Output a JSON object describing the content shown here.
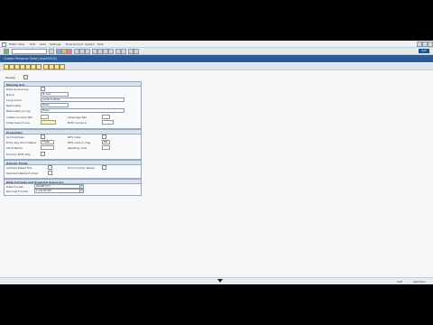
{
  "menu": {
    "items": [
      "Editor View",
      "Edit",
      "Goto",
      "Settings",
      "Environment",
      "System",
      "Help"
    ]
  },
  "appbar": {
    "display_label": "Display"
  },
  "page": {
    "title": "Create Personal Data (Inlo#0002)"
  },
  "groups": {
    "naming": {
      "title": "Naming Sch.",
      "fields": [
        {
          "label": "Data Source key",
          "value": ""
        },
        {
          "label": "Name",
          "value": "Mr Luis"
        },
        {
          "label": "Long name",
          "value": "Lucille D. Brown"
        },
        {
          "label": "Nationality",
          "value": "Brown"
        },
        {
          "label": "Nationality (Long)",
          "value": "Brown"
        },
        {
          "label": "Initials Country Ref",
          "value": ""
        },
        {
          "label": "Initial Search Lev.",
          "value": ""
        }
      ],
      "right_fields": [
        {
          "label": "Language Ref",
          "value": ""
        },
        {
          "label": "Birth Currency",
          "value": ""
        }
      ]
    },
    "properties": {
      "title": "Properties",
      "fields": [
        {
          "label": "Sel Dummies",
          "value": ""
        },
        {
          "label": "Entry Key Short Name",
          "value": "TYLER"
        },
        {
          "label": "Short Name",
          "value": ""
        },
        {
          "label": "Dummy Birth Day",
          "value": ""
        }
      ],
      "right_fields": [
        {
          "label": "DES code",
          "value": ""
        },
        {
          "label": "DES code in msg",
          "value": "BIS"
        },
        {
          "label": "Wedding code",
          "value": ""
        }
      ]
    },
    "addons": {
      "title": "Add-On Fields",
      "fields": [
        {
          "label": "Address Based Ext.",
          "value": ""
        },
        {
          "label": "Standard Name Format",
          "value": ""
        }
      ],
      "right_fields": [
        {
          "label": "Print Country Name",
          "value": ""
        }
      ]
    },
    "data_format": {
      "title": "Data Formats and Regional Sequence",
      "fields": [
        {
          "label": "Date Format",
          "value": "DD.MM.YYYY"
        },
        {
          "label": "Decimal Format",
          "value": "1.234.567,89"
        }
      ]
    }
  },
  "status": {
    "system": "SAP",
    "server": "sapmdev"
  }
}
